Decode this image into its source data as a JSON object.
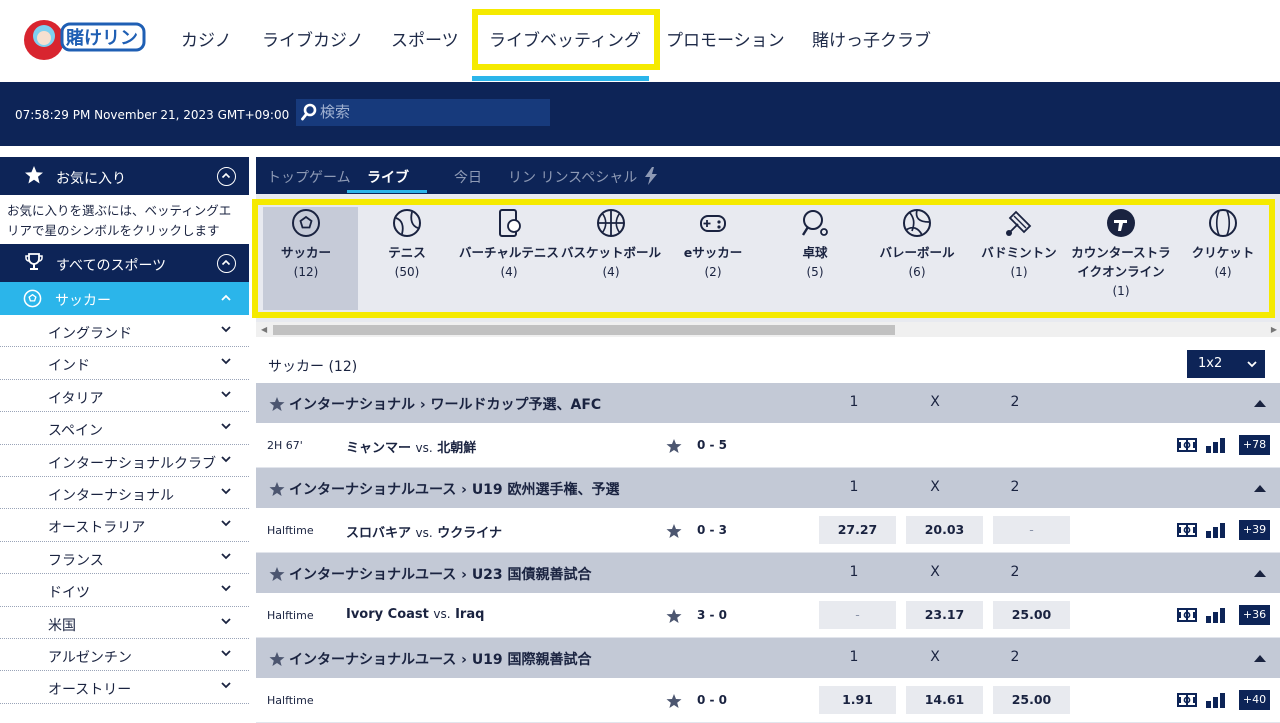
{
  "nav": {
    "logo_text": "賭けリン",
    "items": [
      "カジノ",
      "ライブカジノ",
      "スポーツ",
      "ライブベッティング",
      "プロモーション",
      "賭けっ子クラブ"
    ]
  },
  "bar": {
    "clock": "07:58:29 PM November 21, 2023 GMT+09:00",
    "search_placeholder": "検索"
  },
  "sidebar": {
    "favorites_title": "お気に入り",
    "favorites_hint": "お気に入りを選ぶには、ベッティングエリアで星のシンボルをクリックします",
    "all_sports_title": "すべてのスポーツ",
    "soccer_label": "サッカー",
    "countries": [
      "イングランド",
      "インド",
      "イタリア",
      "スペイン",
      "インターナショナルクラブ",
      "インターナショナル",
      "オーストラリア",
      "フランス",
      "ドイツ",
      "米国",
      "アルゼンチン",
      "オーストリー"
    ]
  },
  "tabs": [
    "トップゲーム",
    "ライブ",
    "今日",
    "リン リンスペシャル"
  ],
  "sports": [
    {
      "name": "サッカー",
      "count": "(12)",
      "icon": "soccer-icon"
    },
    {
      "name": "テニス",
      "count": "(50)",
      "icon": "tennis-icon"
    },
    {
      "name": "バーチャルテニス",
      "count": "(4)",
      "icon": "virtual-tennis-icon"
    },
    {
      "name": "バスケットボール",
      "count": "(4)",
      "icon": "basketball-icon"
    },
    {
      "name": "eサッカー",
      "count": "(2)",
      "icon": "gamepad-icon"
    },
    {
      "name": "卓球",
      "count": "(5)",
      "icon": "table-tennis-icon"
    },
    {
      "name": "バレーボール",
      "count": "(6)",
      "icon": "volleyball-icon"
    },
    {
      "name": "バドミントン",
      "count": "(1)",
      "icon": "badminton-icon"
    },
    {
      "name": "カウンターストライクオンライン",
      "count": "(1)",
      "icon": "counter-strike-icon"
    },
    {
      "name": "クリケット",
      "count": "(4)",
      "icon": "cricket-icon"
    }
  ],
  "list": {
    "title": "サッカー (12)",
    "market": "1x2",
    "col1": "1",
    "colx": "X",
    "col2": "2"
  },
  "leagues": [
    {
      "name": "インターナショナル ›  ワールドカップ予選、AFC",
      "match": {
        "time": "2H 67'",
        "home": "ミャンマー",
        "vs": "vs.",
        "away": "北朝鮮",
        "score": "0 - 5",
        "odds": [],
        "more": "+78"
      }
    },
    {
      "name": "インターナショナルユース ›  U19 欧州選手権、予選",
      "match": {
        "time": "Halftime",
        "home": "スロバキア",
        "vs": "vs.",
        "away": "ウクライナ",
        "score": "0 - 3",
        "odds": [
          "27.27",
          "20.03",
          "-"
        ],
        "more": "+39"
      }
    },
    {
      "name": "インターナショナルユース ›  U23 国債親善試合",
      "match": {
        "time": "Halftime",
        "home": "Ivory Coast",
        "vs": "vs.",
        "away": "Iraq",
        "score": "3 - 0",
        "odds": [
          "-",
          "23.17",
          "25.00"
        ],
        "more": "+36"
      }
    },
    {
      "name": "インターナショナルユース ›  U19 国際親善試合",
      "match": {
        "time": "Halftime",
        "home": "",
        "vs": "",
        "away": "",
        "score": "0 - 0",
        "odds": [
          "1.91",
          "14.61",
          "25.00"
        ],
        "more": "+40"
      }
    }
  ],
  "colors": {
    "navy": "#0d2457",
    "accent": "#2bb5ea",
    "highlight": "#f5ea00"
  }
}
